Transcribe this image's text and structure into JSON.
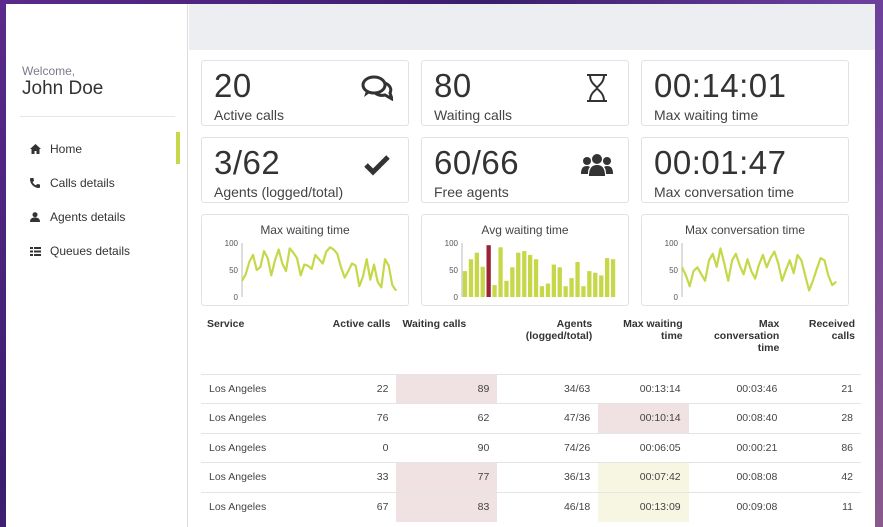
{
  "sidebar": {
    "welcome": "Welcome,",
    "user": "John Doe",
    "nav": [
      {
        "label": "Home",
        "icon": "home-icon"
      },
      {
        "label": "Calls details",
        "icon": "phone-icon"
      },
      {
        "label": "Agents details",
        "icon": "user-icon"
      },
      {
        "label": "Queues details",
        "icon": "list-icon"
      }
    ]
  },
  "stats": [
    {
      "value": "20",
      "label": "Active calls",
      "icon": "comments-icon"
    },
    {
      "value": "80",
      "label": "Waiting calls",
      "icon": "hourglass-icon"
    },
    {
      "value": "00:14:01",
      "label": "Max waiting time",
      "icon": ""
    },
    {
      "value": "3/62",
      "label": "Agents (logged/total)",
      "icon": "check-icon"
    },
    {
      "value": "60/66",
      "label": "Free agents",
      "icon": "users-icon"
    },
    {
      "value": "00:01:47",
      "label": "Max conversation time",
      "icon": ""
    }
  ],
  "chart_data": [
    {
      "type": "line",
      "title": "Max waiting time",
      "ylim": [
        0,
        100
      ],
      "yticks": [
        "100",
        "50",
        "0"
      ],
      "color": "#c6d84a",
      "values": [
        30,
        42,
        65,
        78,
        50,
        55,
        85,
        72,
        40,
        68,
        88,
        62,
        48,
        90,
        82,
        72,
        40,
        60,
        58,
        52,
        78,
        70,
        62,
        84,
        92,
        88,
        80,
        55,
        36,
        48,
        62,
        58,
        20,
        38,
        70,
        32,
        60,
        28,
        18,
        70,
        58,
        22,
        12
      ]
    },
    {
      "type": "bar",
      "title": "Avg waiting time",
      "ylim": [
        0,
        100
      ],
      "yticks": [
        "100",
        "50",
        "0"
      ],
      "color": "#c6d84a",
      "highlight_color": "#9b2335",
      "highlight_index": 4,
      "values": [
        48,
        70,
        82,
        56,
        96,
        22,
        92,
        30,
        55,
        82,
        85,
        78,
        70,
        20,
        25,
        60,
        55,
        20,
        35,
        65,
        20,
        48,
        45,
        40,
        72,
        70
      ]
    },
    {
      "type": "line",
      "title": "Max conversation time",
      "ylim": [
        0,
        100
      ],
      "yticks": [
        "100",
        "50",
        "0"
      ],
      "color": "#c6d84a",
      "values": [
        55,
        40,
        20,
        48,
        55,
        42,
        30,
        68,
        80,
        56,
        90,
        62,
        30,
        68,
        80,
        58,
        42,
        70,
        48,
        34,
        60,
        78,
        55,
        72,
        84,
        62,
        30,
        50,
        68,
        44,
        78,
        68,
        40,
        12,
        30,
        52,
        72,
        68,
        40,
        22,
        28
      ]
    }
  ],
  "table": {
    "headers": [
      [
        "Service"
      ],
      [
        "Active calls"
      ],
      [
        "Waiting calls"
      ],
      [
        "Agents",
        "(logged/total)"
      ],
      [
        "Max waiting",
        "time"
      ],
      [
        "Max",
        "conversation",
        "time"
      ],
      [
        "Received calls"
      ]
    ],
    "rows": [
      [
        "Los Angeles",
        "22",
        "89",
        "34/63",
        "00:13:14",
        "00:03:46",
        "21"
      ],
      [
        "Los Angeles",
        "76",
        "62",
        "47/36",
        "00:10:14",
        "00:08:40",
        "28"
      ],
      [
        "Los Angeles",
        "0",
        "90",
        "74/26",
        "00:06:05",
        "00:00:21",
        "86"
      ],
      [
        "Los Angeles",
        "33",
        "77",
        "36/13",
        "00:07:42",
        "00:08:08",
        "42"
      ],
      [
        "Los Angeles",
        "67",
        "83",
        "46/18",
        "00:13:09",
        "00:09:08",
        "11"
      ]
    ],
    "highlights": {
      "0-2": "red",
      "1-4": "red",
      "3-2": "red",
      "3-4": "yellow",
      "4-2": "red",
      "4-4": "yellow"
    }
  }
}
